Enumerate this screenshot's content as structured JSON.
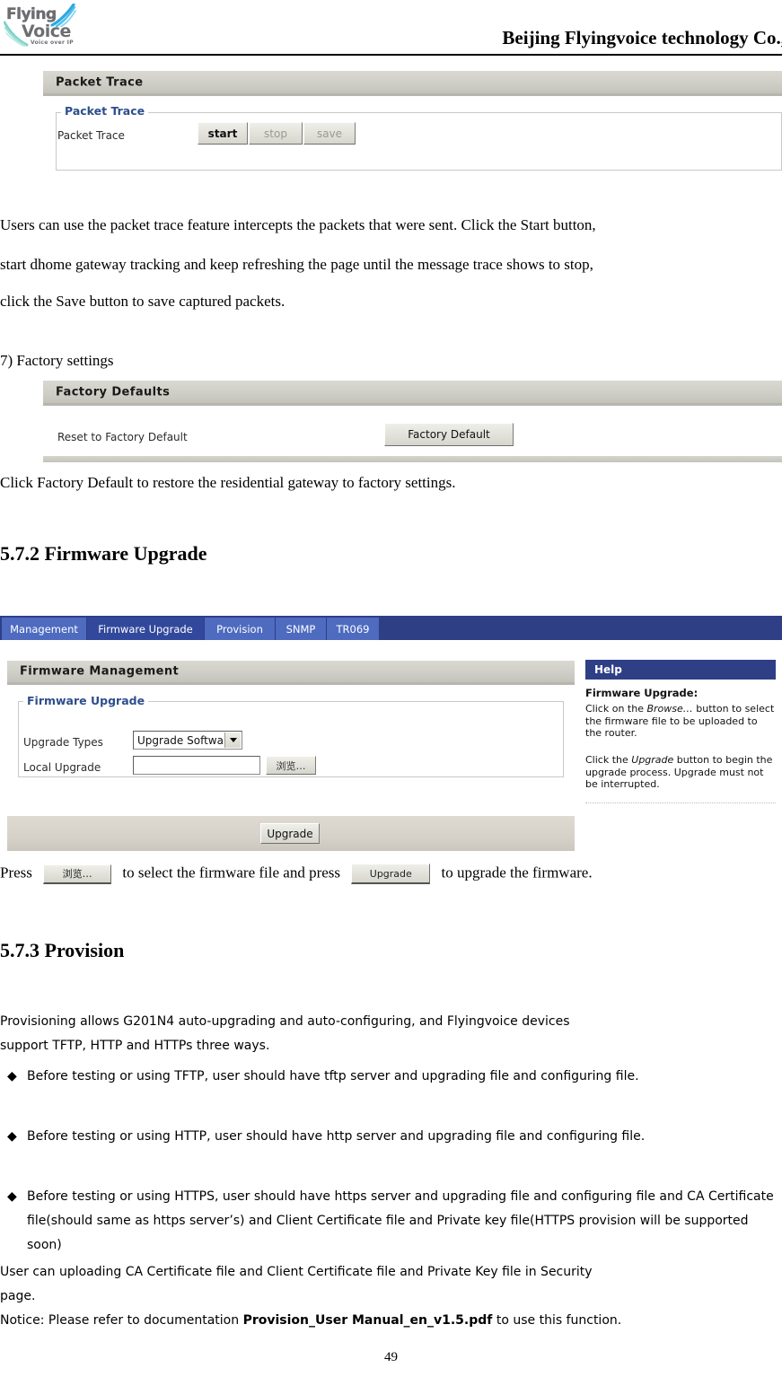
{
  "header": {
    "company": "Beijing Flyingvoice technology Co.,",
    "logo": {
      "word1": "Flying",
      "word2": "Voice",
      "tagline": "Voice over IP"
    }
  },
  "packet_trace_panel": {
    "panel_title": "Packet Trace",
    "legend": "Packet Trace",
    "row_label": "Packet Trace",
    "buttons": {
      "start": "start",
      "stop": "stop",
      "save": "save"
    }
  },
  "paragraphs": {
    "packet_trace_desc_l1": "Users can use the packet trace feature intercepts the packets that were sent. Click the Start button,",
    "packet_trace_desc_l2": "start dhome gateway tracking and keep refreshing the page until the message trace shows to stop,",
    "packet_trace_desc_l3": "click the Save button to save captured packets.",
    "factory_settings_item": "7) Factory settings",
    "factory_desc": "Click Factory Default to restore the residential gateway to factory settings."
  },
  "factory_panel": {
    "panel_title": "Factory Defaults",
    "row_label": "Reset to Factory Default",
    "button": "Factory Default"
  },
  "headings": {
    "firmware_upgrade": "5.7.2 Firmware Upgrade",
    "provision": "5.7.3 Provision"
  },
  "firmware": {
    "tabs": [
      {
        "label": "Management",
        "active": false
      },
      {
        "label": "Firmware Upgrade",
        "active": true
      },
      {
        "label": "Provision",
        "active": false
      },
      {
        "label": "SNMP",
        "active": false
      },
      {
        "label": "TR069",
        "active": false
      }
    ],
    "panel_title": "Firmware Management",
    "legend": "Firmware Upgrade",
    "upgrade_types_label": "Upgrade Types",
    "upgrade_types_value": "Upgrade Software",
    "local_upgrade_label": "Local Upgrade",
    "local_upgrade_value": "",
    "browse_button": "浏览…",
    "upgrade_button": "Upgrade"
  },
  "help": {
    "title": "Help",
    "subtitle": "Firmware Upgrade:",
    "para1_pre": "Click on the ",
    "para1_em": "Browse…",
    "para1_post": " button to select the firmware file to be uploaded to the router.",
    "para2_pre": "Click the ",
    "para2_em": "Upgrade",
    "para2_post": " button to begin the upgrade process. Upgrade must not be interrupted."
  },
  "press_line": {
    "pre": "Press",
    "browse_button": "浏览…",
    "mid": "to select the firmware file and press",
    "upgrade_button": "Upgrade",
    "post": "to upgrade the firmware."
  },
  "provision": {
    "intro_l1": "Provisioning allows G201N4 auto-upgrading and auto-configuring, and Flyingvoice devices",
    "intro_l2": "support TFTP, HTTP and HTTPs three ways.",
    "bullet_mark": "◆",
    "bullets": [
      "Before testing or using TFTP, user should have tftp server and upgrading file and configuring file.",
      "Before testing or using HTTP, user should have http server and upgrading file and configuring file.",
      "Before testing or using HTTPS, user should have https server and upgrading file and configuring file and CA Certificate file(should same as https server’s) and Client Certificate file and Private key file(HTTPS provision will be supported soon)"
    ],
    "closing_l1": "User can uploading CA Certificate file and Client Certificate file and Private Key file in Security",
    "closing_l2": "page.",
    "notice_pre": "Notice: Please refer to documentation ",
    "notice_bold": "Provision_User Manual_en_v1.5.pdf",
    "notice_post": " to use this function."
  },
  "page_number": "49",
  "colors": {
    "tab_bar": "#2e3f86",
    "tab": "#4e6bc0",
    "tab_active": "#32489c",
    "legend_blue": "#2d4e8c",
    "panel_grey": "#cfcfc7"
  }
}
